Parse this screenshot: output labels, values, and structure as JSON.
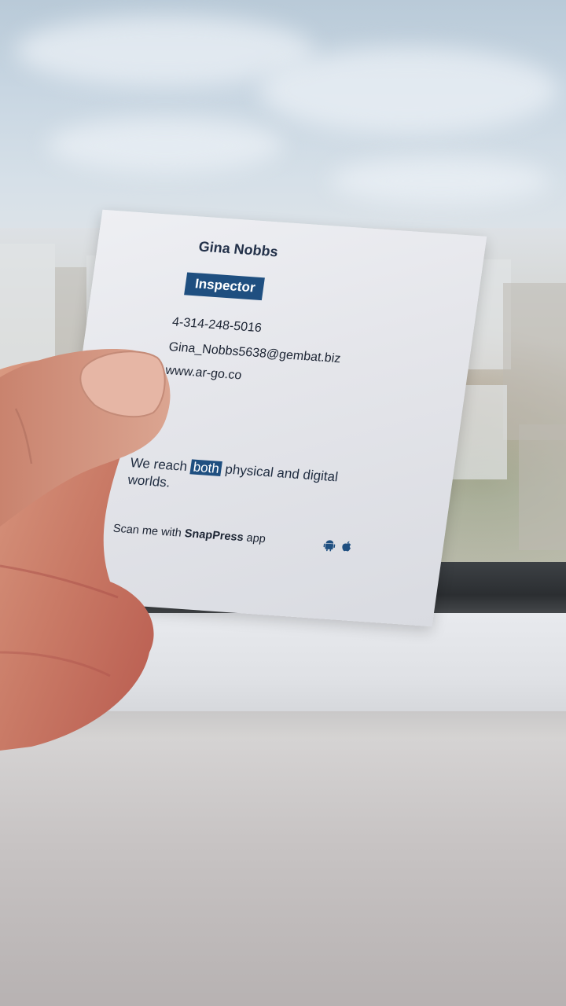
{
  "card": {
    "name": "Gina Nobbs",
    "title": "Inspector",
    "phone": "4-314-248-5016",
    "email": "Gina_Nobbs5638@gembat.biz",
    "website": "www.ar-go.co",
    "tagline": {
      "part1": "We reach",
      "highlight": "both",
      "part2": "physical and digital worlds."
    },
    "scan": {
      "prefix": "Scan me with",
      "app_name": "SnapPress",
      "suffix": "app"
    },
    "icons": [
      "android-icon",
      "apple-icon"
    ],
    "colors": {
      "accent": "#1f4f80",
      "text": "#1c2433",
      "card": "#e6e7ec"
    }
  }
}
